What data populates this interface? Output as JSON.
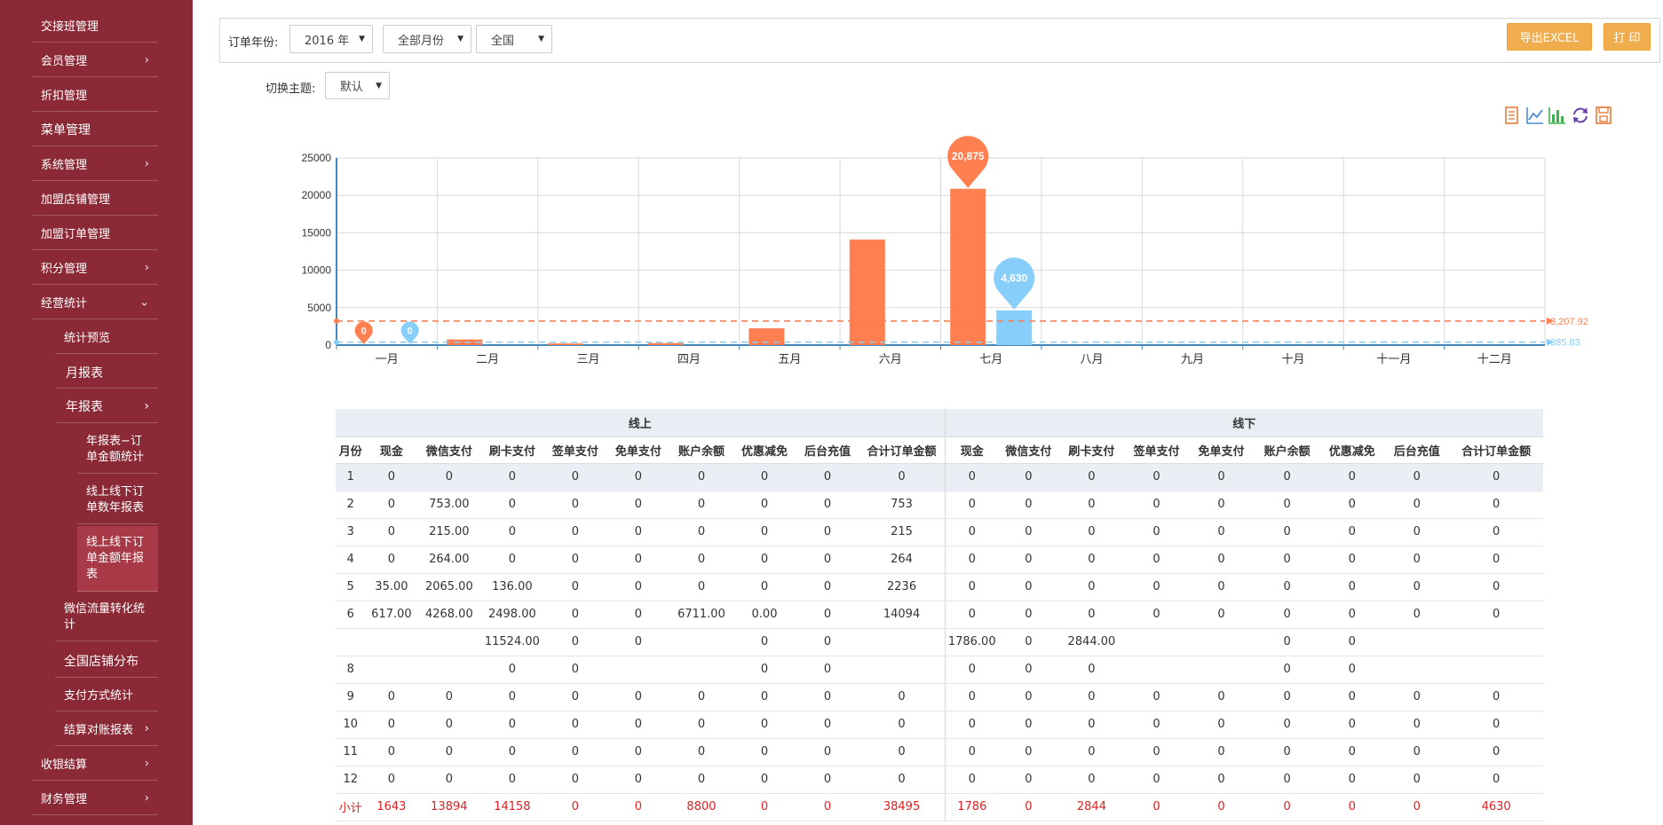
{
  "sidebar": {
    "items": [
      {
        "label": "交接班管理",
        "chevron": ""
      },
      {
        "label": "会员管理",
        "chevron": "›"
      },
      {
        "label": "折扣管理",
        "chevron": ""
      },
      {
        "label": "菜单管理",
        "chevron": ""
      },
      {
        "label": "系统管理",
        "chevron": "›"
      },
      {
        "label": "加盟店铺管理",
        "chevron": ""
      },
      {
        "label": "加盟订单管理",
        "chevron": ""
      },
      {
        "label": "积分管理",
        "chevron": "›"
      },
      {
        "label": "经营统计",
        "chevron": "⌄"
      }
    ],
    "stats_sub": {
      "preview": "统计预览",
      "monthly": "月报表",
      "yearly": "年报表",
      "yearly_chevron": "›",
      "yearly_children": [
        "年报表−订单金额统计",
        "线上线下订单数年报表",
        "线上线下订单金额年报表"
      ],
      "wechat": "微信流量转化统计",
      "stores": "全国店铺分布",
      "payment": "支付方式统计",
      "settle": "结算对账报表",
      "settle_chevron": "›"
    },
    "bottom_items": [
      {
        "label": "收银结算",
        "chevron": "›"
      },
      {
        "label": "财务管理",
        "chevron": "›"
      }
    ]
  },
  "filters": {
    "year_label": "订单年份:",
    "year_value": "2016 年",
    "month_value": "全部月份",
    "region_value": "全国",
    "theme_label": "切换主题:",
    "theme_value": "默认",
    "export_label": "导出EXCEL",
    "print_label": "打 印"
  },
  "toolbox_icons": [
    "data-view-icon",
    "line-chart-icon",
    "bar-chart-icon",
    "restore-icon",
    "save-image-icon"
  ],
  "colors": {
    "online": "#ff7f50",
    "offline": "#87cefa",
    "sidebar": "#8b2a36",
    "button": "#f0ad4e",
    "total": "#e02020"
  },
  "chart_data": {
    "type": "bar",
    "categories": [
      "一月",
      "二月",
      "三月",
      "四月",
      "五月",
      "六月",
      "七月",
      "八月",
      "九月",
      "十月",
      "十一月",
      "十二月"
    ],
    "series": [
      {
        "values": [
          0,
          753,
          215,
          264,
          2236,
          14094,
          20875,
          0,
          0,
          0,
          0,
          0
        ],
        "color": "#ff7f50"
      },
      {
        "values": [
          0,
          0,
          0,
          0,
          0,
          0,
          4630,
          0,
          0,
          0,
          0,
          0
        ],
        "color": "#87cefa"
      }
    ],
    "ylim": [
      0,
      25000
    ],
    "yticks": [
      "0",
      "5000",
      "10000",
      "15000",
      "20000",
      "25000"
    ],
    "mark_points": [
      {
        "series": 0,
        "index": 0,
        "label": "0"
      },
      {
        "series": 1,
        "index": 0,
        "label": "0"
      },
      {
        "series": 0,
        "index": 6,
        "label": "20,875"
      },
      {
        "series": 1,
        "index": 6,
        "label": "4,630"
      }
    ],
    "mark_lines": [
      {
        "series": 0,
        "value": 3207.92,
        "label": "3,207.92"
      },
      {
        "series": 1,
        "value": 385.83,
        "label": "385.83"
      }
    ],
    "grid": true
  },
  "table": {
    "group_online": "线上",
    "group_offline": "线下",
    "headers": [
      "月份",
      "现金",
      "微信支付",
      "刷卡支付",
      "签单支付",
      "免单支付",
      "账户余额",
      "优惠减免",
      "后台充值",
      "合计订单金额",
      "现金",
      "微信支付",
      "刷卡支付",
      "签单支付",
      "免单支付",
      "账户余额",
      "优惠减免",
      "后台充值",
      "合计订单金额"
    ],
    "rows": [
      [
        "1",
        "0",
        "0",
        "0",
        "0",
        "0",
        "0",
        "0",
        "0",
        "0",
        "0",
        "0",
        "0",
        "0",
        "0",
        "0",
        "0",
        "0",
        "0"
      ],
      [
        "2",
        "0",
        "753.00",
        "0",
        "0",
        "0",
        "0",
        "0",
        "0",
        "753",
        "0",
        "0",
        "0",
        "0",
        "0",
        "0",
        "0",
        "0",
        "0"
      ],
      [
        "3",
        "0",
        "215.00",
        "0",
        "0",
        "0",
        "0",
        "0",
        "0",
        "215",
        "0",
        "0",
        "0",
        "0",
        "0",
        "0",
        "0",
        "0",
        "0"
      ],
      [
        "4",
        "0",
        "264.00",
        "0",
        "0",
        "0",
        "0",
        "0",
        "0",
        "264",
        "0",
        "0",
        "0",
        "0",
        "0",
        "0",
        "0",
        "0",
        "0"
      ],
      [
        "5",
        "35.00",
        "2065.00",
        "136.00",
        "0",
        "0",
        "0",
        "0",
        "0",
        "2236",
        "0",
        "0",
        "0",
        "0",
        "0",
        "0",
        "0",
        "0",
        "0"
      ],
      [
        "6",
        "617.00",
        "4268.00",
        "2498.00",
        "0",
        "0",
        "6711.00",
        "0.00",
        "0",
        "14094",
        "0",
        "0",
        "0",
        "0",
        "0",
        "0",
        "0",
        "0",
        "0"
      ],
      [
        "",
        "",
        "",
        "11524.00",
        "0",
        "0",
        "",
        "0",
        "0",
        "",
        "1786.00",
        "0",
        "2844.00",
        "",
        "",
        "0",
        "0",
        "",
        ""
      ],
      [
        "8",
        "",
        "",
        "0",
        "0",
        "",
        "",
        "0",
        "0",
        "",
        "0",
        "0",
        "0",
        "",
        "",
        "0",
        "0",
        "",
        ""
      ],
      [
        "9",
        "0",
        "0",
        "0",
        "0",
        "0",
        "0",
        "0",
        "0",
        "0",
        "0",
        "0",
        "0",
        "0",
        "0",
        "0",
        "0",
        "0",
        "0"
      ],
      [
        "10",
        "0",
        "0",
        "0",
        "0",
        "0",
        "0",
        "0",
        "0",
        "0",
        "0",
        "0",
        "0",
        "0",
        "0",
        "0",
        "0",
        "0",
        "0"
      ],
      [
        "11",
        "0",
        "0",
        "0",
        "0",
        "0",
        "0",
        "0",
        "0",
        "0",
        "0",
        "0",
        "0",
        "0",
        "0",
        "0",
        "0",
        "0",
        "0"
      ],
      [
        "12",
        "0",
        "0",
        "0",
        "0",
        "0",
        "0",
        "0",
        "0",
        "0",
        "0",
        "0",
        "0",
        "0",
        "0",
        "0",
        "0",
        "0",
        "0"
      ]
    ],
    "total": [
      "小计",
      "1643",
      "13894",
      "14158",
      "0",
      "0",
      "8800",
      "0",
      "0",
      "38495",
      "1786",
      "0",
      "2844",
      "0",
      "0",
      "0",
      "0",
      "0",
      "4630"
    ]
  }
}
